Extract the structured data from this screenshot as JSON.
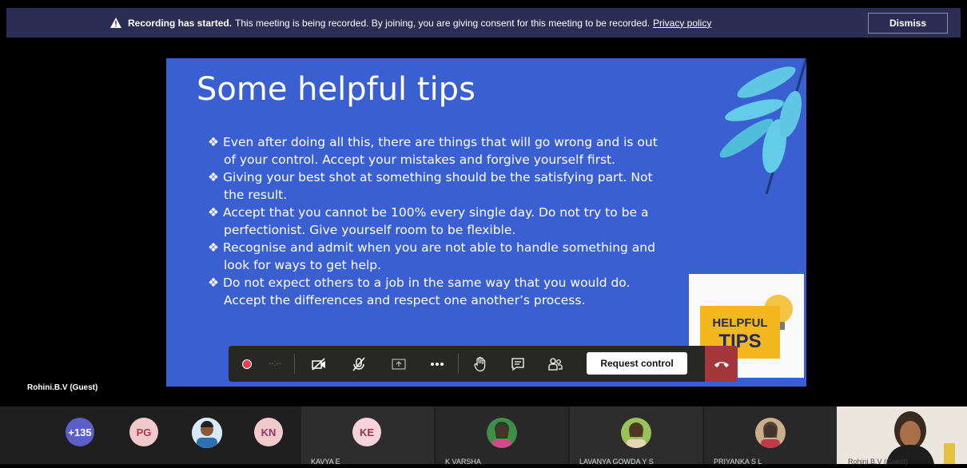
{
  "banner": {
    "title": "Recording has started.",
    "message": "This meeting is being recorded. By joining, you are giving consent for this meeting to be recorded.",
    "link": "Privacy policy",
    "dismiss": "Dismiss"
  },
  "slide": {
    "title": "Some helpful tips",
    "bullet_glyph": "❖",
    "tips": [
      {
        "line1": "Even after doing all this, there are things that will go wrong and is out",
        "line2": "of your control. Accept your mistakes and forgive yourself first."
      },
      {
        "line1": "Giving your best shot at something should be the satisfying part. Not",
        "line2": "the result."
      },
      {
        "line1": "Accept that you cannot be 100% every single day. Do not try to be a",
        "line2": "perfectionist. Give yourself room to be flexible."
      },
      {
        "line1": "Recognise and admit when you are not able to handle something and",
        "line2": "look for ways to get help."
      },
      {
        "line1": "Do not expect others to a job in the same way that you would do.",
        "line2": "Accept the differences and respect one another’s process."
      }
    ],
    "card": {
      "word1": "HELPFUL",
      "word2": "TIPS"
    }
  },
  "controls": {
    "timer": "--:--",
    "request_control": "Request control"
  },
  "presenter": {
    "label": "Rohini.B.V (Guest)"
  },
  "participants": {
    "overflow": "+135",
    "initials": [
      {
        "initials": "PG",
        "bg": "#f2c9cb",
        "fg": "#a33f48"
      },
      {
        "initials": "KN",
        "bg": "#f2c9cb",
        "fg": "#8a3a66"
      },
      {
        "initials": "KE",
        "bg": "#f7d4dc",
        "fg": "#9a3344"
      }
    ],
    "names": [
      "KAVYA E",
      "K VARSHA",
      "LAVANYA GOWDA Y S",
      "PRIYANKA S L",
      "Rohini.B.V (Guest)"
    ]
  },
  "colors": {
    "banner_bg": "#2b2d54",
    "slide_bg": "#3a5fd0",
    "hangup": "#a4373a",
    "overflow_avatar": "#5b5fc7"
  }
}
